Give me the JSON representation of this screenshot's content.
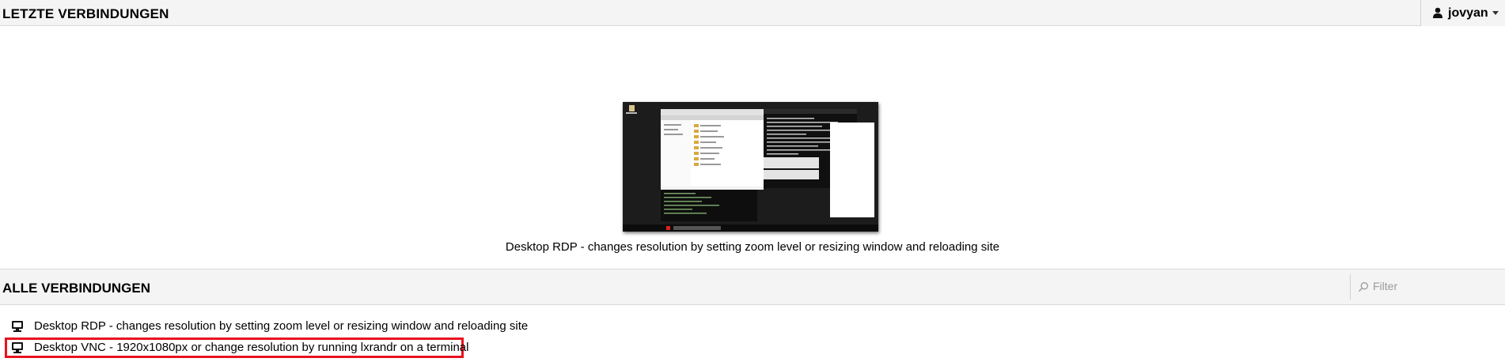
{
  "header": {
    "title": "LETZTE VERBINDUNGEN",
    "user": {
      "name": "jovyan",
      "icon": "user-icon"
    }
  },
  "recent": {
    "items": [
      {
        "label": "Desktop RDP - changes resolution by setting zoom level or resizing window and reloading site"
      }
    ]
  },
  "all_connections": {
    "title": "ALLE VERBINDUNGEN",
    "filter": {
      "placeholder": "Filter",
      "value": "",
      "icon": "search-icon"
    },
    "items": [
      {
        "label": "Desktop RDP - changes resolution by setting zoom level or resizing window and reloading site",
        "icon": "desktop-icon",
        "selected": false
      },
      {
        "label": "Desktop VNC - 1920x1080px or change resolution by running lxrandr on a terminal",
        "icon": "desktop-icon",
        "selected": true
      }
    ]
  },
  "colors": {
    "selection_border": "#e8121f",
    "header_bg": "#f4f4f4"
  }
}
